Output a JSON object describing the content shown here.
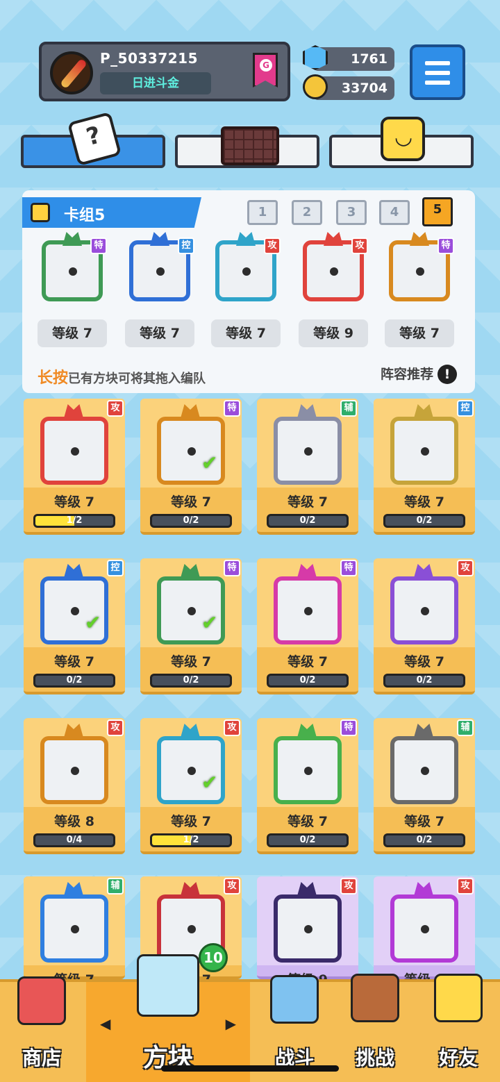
{
  "profile": {
    "player_id": "P_50337215",
    "title": "日进斗金",
    "rank_badge": "G"
  },
  "currency": {
    "gems": "1761",
    "coins": "33704"
  },
  "deck": {
    "title": "卡组5",
    "slots": [
      "1",
      "2",
      "3",
      "4",
      "5"
    ],
    "active_slot": "5",
    "cards": [
      {
        "tag": "特",
        "level": "等级 7",
        "color": "#3f9a55"
      },
      {
        "tag": "控",
        "level": "等级 7",
        "color": "#2f6fd6"
      },
      {
        "tag": "攻",
        "level": "等级 7",
        "color": "#2fa4c9"
      },
      {
        "tag": "攻",
        "level": "等级 9",
        "color": "#e0433c"
      },
      {
        "tag": "特",
        "level": "等级 7",
        "color": "#d8891f"
      }
    ],
    "hint_highlight": "长按",
    "hint_text": "已有方块可将其拖入编队",
    "recommend": "阵容推荐",
    "recommend_icon": "!"
  },
  "collection": [
    {
      "tag": "攻",
      "level": "等级 7",
      "progress": "1/2",
      "progress_value": 0.5,
      "color": "#e0433c",
      "equipped": false
    },
    {
      "tag": "特",
      "level": "等级 7",
      "progress": "0/2",
      "progress_value": 0,
      "color": "#d8891f",
      "equipped": true
    },
    {
      "tag": "辅",
      "level": "等级 7",
      "progress": "0/2",
      "progress_value": 0,
      "color": "#8a8ea6",
      "equipped": false
    },
    {
      "tag": "控",
      "level": "等级 7",
      "progress": "0/2",
      "progress_value": 0,
      "color": "#c6a43a",
      "equipped": false
    },
    {
      "tag": "控",
      "level": "等级 7",
      "progress": "0/2",
      "progress_value": 0,
      "color": "#2f6fd6",
      "equipped": true
    },
    {
      "tag": "特",
      "level": "等级 7",
      "progress": "0/2",
      "progress_value": 0,
      "color": "#3f9a55",
      "equipped": true
    },
    {
      "tag": "特",
      "level": "等级 7",
      "progress": "0/2",
      "progress_value": 0,
      "color": "#d63aa8",
      "equipped": false
    },
    {
      "tag": "攻",
      "level": "等级 7",
      "progress": "0/2",
      "progress_value": 0,
      "color": "#8a4fd6",
      "equipped": false
    },
    {
      "tag": "攻",
      "level": "等级 8",
      "progress": "0/4",
      "progress_value": 0,
      "color": "#d8891f",
      "equipped": false
    },
    {
      "tag": "攻",
      "level": "等级 7",
      "progress": "1/2",
      "progress_value": 0.5,
      "color": "#2fa4c9",
      "equipped": true
    },
    {
      "tag": "特",
      "level": "等级 7",
      "progress": "0/2",
      "progress_value": 0,
      "color": "#48b04c",
      "equipped": false
    },
    {
      "tag": "辅",
      "level": "等级 7",
      "progress": "0/2",
      "progress_value": 0,
      "color": "#6a6a6a",
      "equipped": false
    },
    {
      "tag": "辅",
      "level": "等级 7",
      "progress": "",
      "progress_value": 0,
      "color": "#2f7fe0",
      "equipped": false
    },
    {
      "tag": "攻",
      "level": "等级 7",
      "progress": "",
      "progress_value": 0,
      "color": "#c8323a",
      "equipped": false
    },
    {
      "tag": "攻",
      "level": "等级 9",
      "progress": "",
      "progress_value": 0,
      "color": "#3a2a6a",
      "equipped": false
    },
    {
      "tag": "攻",
      "level": "等级 8",
      "progress": "",
      "progress_value": 0,
      "color": "#b23ad6",
      "equipped": false
    }
  ],
  "nav": {
    "shop": "商店",
    "blocks": "方块",
    "battle": "战斗",
    "challenge": "挑战",
    "friends": "好友",
    "blocks_badge": "10",
    "arrow_left": "◀",
    "arrow_right": "▶"
  },
  "colors": {
    "accent_blue": "#2f8ee8",
    "card_gold": "#f5be55",
    "card_purple": "#cfb6f2"
  }
}
